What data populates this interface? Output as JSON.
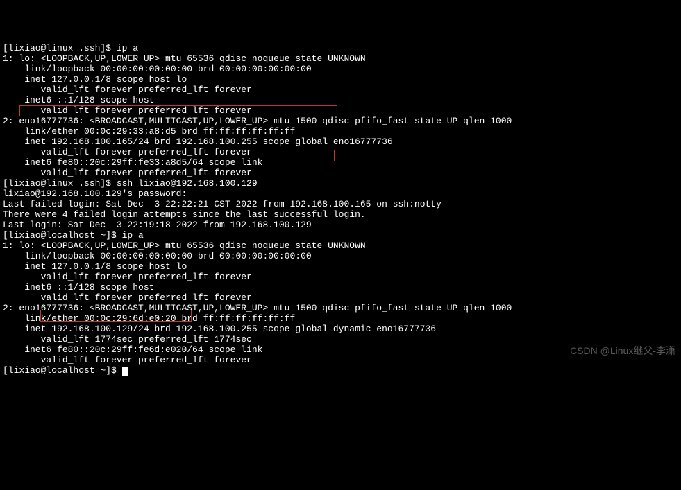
{
  "lines": [
    "[lixiao@linux .ssh]$ ip a",
    "1: lo: <LOOPBACK,UP,LOWER_UP> mtu 65536 qdisc noqueue state UNKNOWN",
    "    link/loopback 00:00:00:00:00:00 brd 00:00:00:00:00:00",
    "    inet 127.0.0.1/8 scope host lo",
    "       valid_lft forever preferred_lft forever",
    "    inet6 ::1/128 scope host",
    "       valid_lft forever preferred_lft forever",
    "2: eno16777736: <BROADCAST,MULTICAST,UP,LOWER_UP> mtu 1500 qdisc pfifo_fast state UP qlen 1000",
    "    link/ether 00:0c:29:33:a8:d5 brd ff:ff:ff:ff:ff:ff",
    "    inet 192.168.100.165/24 brd 192.168.100.255 scope global eno16777736",
    "       valid_lft forever preferred_lft forever",
    "    inet6 fe80::20c:29ff:fe33:a8d5/64 scope link",
    "       valid_lft forever preferred_lft forever",
    "[lixiao@linux .ssh]$ ssh lixiao@192.168.100.129",
    "lixiao@192.168.100.129's password:",
    "Last failed login: Sat Dec  3 22:22:21 CST 2022 from 192.168.100.165 on ssh:notty",
    "There were 4 failed login attempts since the last successful login.",
    "Last login: Sat Dec  3 22:19:18 2022 from 192.168.100.129",
    "[lixiao@localhost ~]$ ip a",
    "1: lo: <LOOPBACK,UP,LOWER_UP> mtu 65536 qdisc noqueue state UNKNOWN",
    "    link/loopback 00:00:00:00:00:00 brd 00:00:00:00:00:00",
    "    inet 127.0.0.1/8 scope host lo",
    "       valid_lft forever preferred_lft forever",
    "    inet6 ::1/128 scope host",
    "       valid_lft forever preferred_lft forever",
    "2: eno16777736: <BROADCAST,MULTICAST,UP,LOWER_UP> mtu 1500 qdisc pfifo_fast state UP qlen 1000",
    "    link/ether 00:0c:29:6d:e0:20 brd ff:ff:ff:ff:ff:ff",
    "    inet 192.168.100.129/24 brd 192.168.100.255 scope global dynamic eno16777736",
    "       valid_lft 1774sec preferred_lft 1774sec",
    "    inet6 fe80::20c:29ff:fe6d:e020/64 scope link",
    "       valid_lft forever preferred_lft forever",
    "[lixiao@localhost ~]$ "
  ],
  "watermark": "CSDN @Linux继父-李潇"
}
